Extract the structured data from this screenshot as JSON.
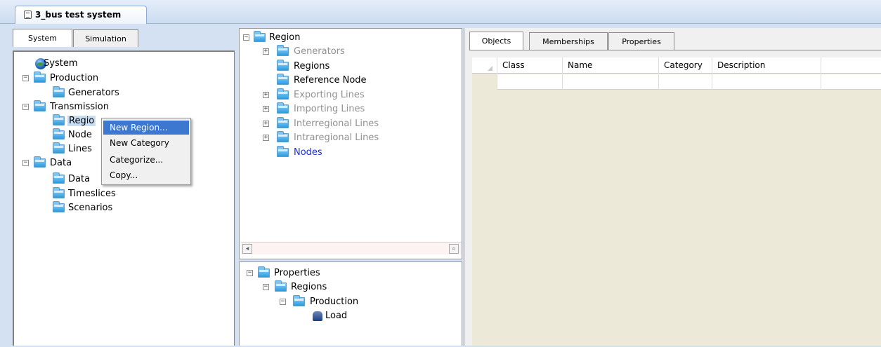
{
  "document_tab": {
    "title": "3_bus test system",
    "icon": "document-icon"
  },
  "left_panel": {
    "tabs": [
      "System",
      "Simulation"
    ],
    "tree": [
      {
        "label": "System",
        "icon": "globe-icon"
      },
      {
        "label": "Production",
        "icon": "folder-icon",
        "expander": "−"
      },
      {
        "label": "Generators",
        "icon": "folder-icon"
      },
      {
        "label": "Transmission",
        "icon": "folder-icon",
        "expander": "−"
      },
      {
        "label": "Regio",
        "icon": "folder-icon"
      },
      {
        "label": "Node",
        "icon": "folder-icon"
      },
      {
        "label": "Lines",
        "icon": "folder-icon"
      },
      {
        "label": "Data",
        "icon": "folder-icon",
        "expander": "−"
      },
      {
        "label": "Data",
        "icon": "folder-icon"
      },
      {
        "label": "Timeslices",
        "icon": "folder-icon"
      },
      {
        "label": "Scenarios",
        "icon": "folder-icon"
      }
    ]
  },
  "context_menu": {
    "items": [
      "New Region...",
      "New Category",
      "Categorize...",
      "Copy..."
    ],
    "highlighted": "New Region..."
  },
  "middle_top_tree": [
    {
      "label": "Region",
      "expander": "−",
      "style": "normal"
    },
    {
      "label": "Generators",
      "expander": "+",
      "style": "grey"
    },
    {
      "label": "Regions",
      "style": "normal"
    },
    {
      "label": "Reference Node",
      "style": "normal"
    },
    {
      "label": "Exporting Lines",
      "expander": "+",
      "style": "grey"
    },
    {
      "label": "Importing Lines",
      "expander": "+",
      "style": "grey"
    },
    {
      "label": "Interregional Lines",
      "expander": "+",
      "style": "grey"
    },
    {
      "label": "Intraregional Lines",
      "expander": "+",
      "style": "grey"
    },
    {
      "label": "Nodes",
      "style": "blue"
    }
  ],
  "middle_bottom_tree": [
    {
      "label": "Properties",
      "expander": "−",
      "icon": "folder-icon"
    },
    {
      "label": "Regions",
      "expander": "−",
      "icon": "folder-icon"
    },
    {
      "label": "Production",
      "expander": "−",
      "icon": "folder-icon"
    },
    {
      "label": "Load",
      "icon": "load-icon"
    }
  ],
  "right_panel": {
    "tabs": [
      "Objects",
      "Memberships",
      "Properties"
    ],
    "columns": [
      "Class",
      "Name",
      "Category",
      "Description"
    ]
  },
  "colors": {
    "accent_highlight": "#3c78d0",
    "blue_link": "#1a2fdc",
    "grey_text": "#909090"
  }
}
